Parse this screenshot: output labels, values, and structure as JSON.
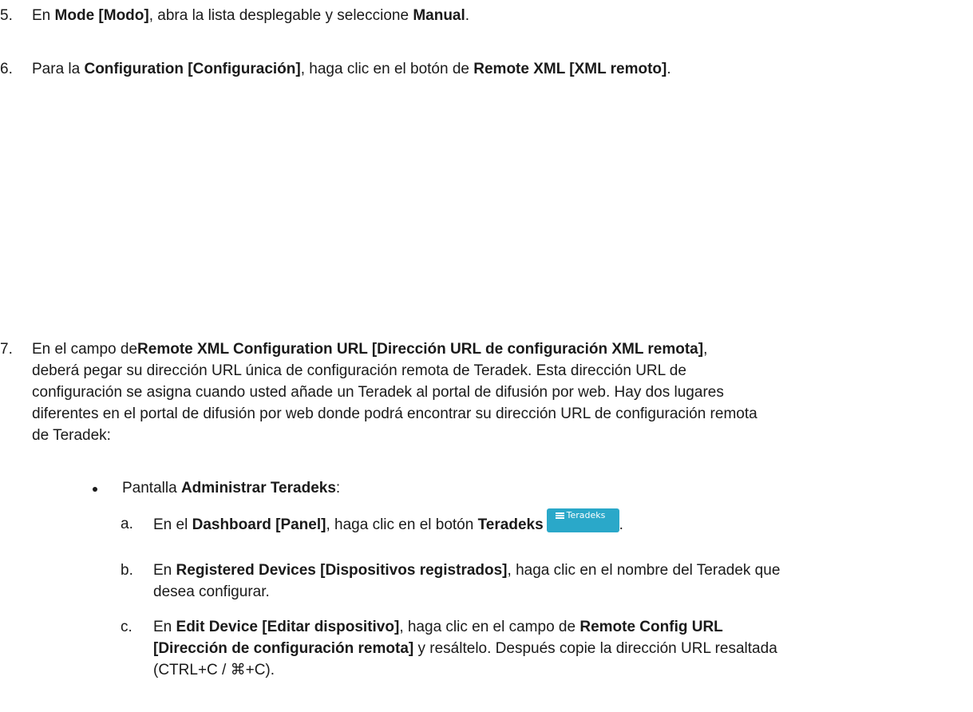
{
  "step5": {
    "number": "5.",
    "t1": "En ",
    "b1": "Mode [Modo]",
    "t2": ", abra la lista desplegable y seleccione ",
    "b2": "Manual",
    "t3": "."
  },
  "step6": {
    "number": "6.",
    "t1": "Para la ",
    "b1": "Configuration [Configuración]",
    "t2": ", haga clic en el botón de ",
    "b2": "Remote XML [XML remoto]",
    "t3": "."
  },
  "step7": {
    "number": "7.",
    "line1_text": "En el campo de",
    "line1_bold": "Remote XML Configuration URL [Dirección URL de configuración XML remota]",
    "line1_end": ",",
    "line2": "deberá pegar su dirección URL única de configuración remota de Teradek. Esta dirección URL de",
    "line3": "configuración se asigna cuando usted añade un Teradek al portal de difusión por web. Hay dos lugares",
    "line4": "diferentes en el portal de difusión por web donde podrá encontrar su dirección URL de configuración remota",
    "line5": "de Teradek:"
  },
  "bullet": {
    "t1": "Pantalla ",
    "b1": "Administrar Teradeks",
    "t2": ":"
  },
  "substep_a": {
    "letter": "a.",
    "t1": "En el ",
    "b1": "Dashboard [Panel]",
    "t2": ", haga clic en el botón ",
    "b2": "Teradeks",
    "button_label": "Teradeks",
    "t3": "."
  },
  "substep_b": {
    "letter": "b.",
    "t1": "En ",
    "b1": "Registered Devices [Dispositivos registrados]",
    "t2": ", haga clic en el nombre del Teradek que",
    "line2": "desea configurar."
  },
  "substep_c": {
    "letter": "c.",
    "t1": "En ",
    "b1": "Edit Device [Editar dispositivo]",
    "t2": ", haga clic en el campo de ",
    "b2": "Remote Config URL",
    "line2_bold": "[Dirección de configuración remota]",
    "line2_end": " y resáltelo. Después copie la dirección URL resaltada",
    "line3": "(CTRL+C / ⌘+C)."
  },
  "colors": {
    "text": "#1a1a1a",
    "button_bg": "#2aa8c9",
    "button_text": "#ffffff"
  },
  "icons": {
    "teradeks_button_icon": "list-icon"
  }
}
